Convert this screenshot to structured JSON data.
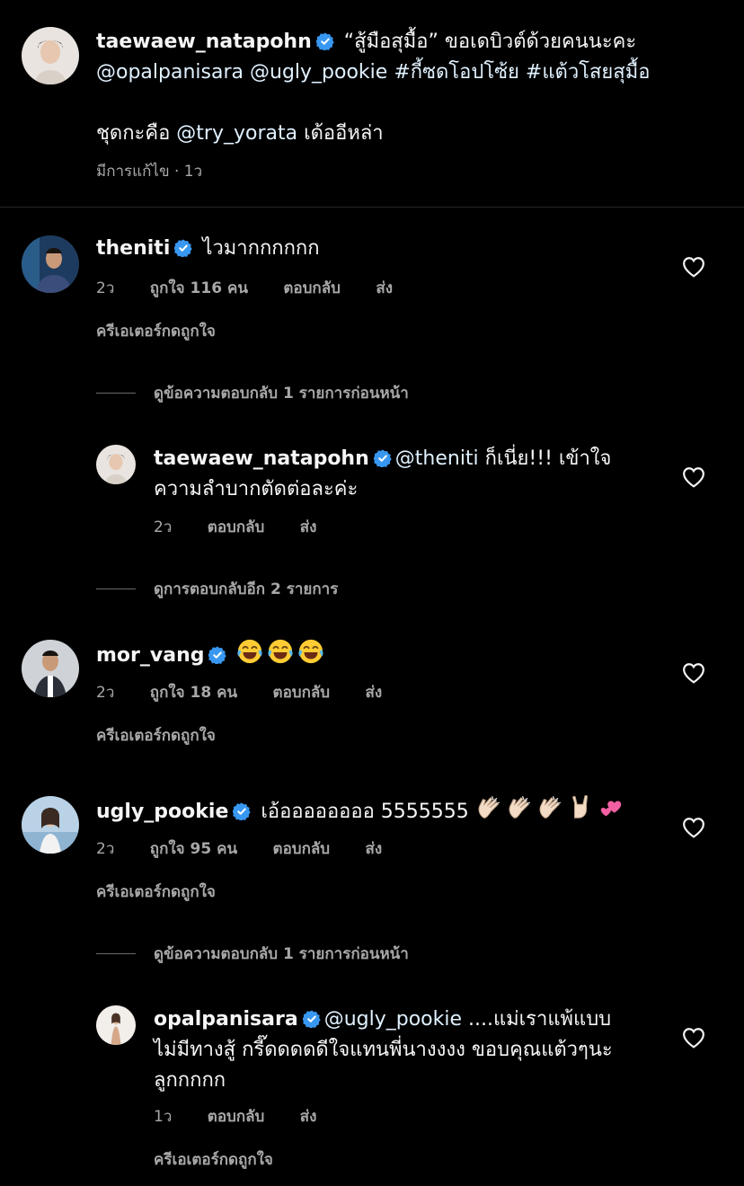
{
  "caption": {
    "username": "taewaew_natapohn",
    "line1": "“สู้มือสุมื้อ” ขอเดบิวต์ด้วยคนนะคะ",
    "line2_tags": [
      "@opalpanisara",
      "@ugly_pookie",
      "#กี้ซดโอปโซ้ย",
      "#แต้วโสยสุมื้อ"
    ],
    "line3_text": "ชุดกะคือ ",
    "line3_mention": "@try_yorata",
    "line3_after": " เด้ออีหล่า",
    "edited": "มีการแก้ไข · 1ว"
  },
  "comments": [
    {
      "username": "theniti",
      "text": "ไวมากกกกกก",
      "time": "2ว",
      "likes": "ถูกใจ 116 คน",
      "reply": "ตอบกลับ",
      "send": "ส่ง",
      "creator_liked": "ครีเอเตอร์กดถูกใจ",
      "view_replies": "ดูข้อความตอบกลับ 1 รายการก่อนหน้า"
    },
    {
      "username": "taewaew_natapohn",
      "mention": "@theniti",
      "text_line1": " ก็เนี่ย!!! เข้าใจ",
      "text_line2": "ความลำบากตัดต่อละค่ะ",
      "time": "2ว",
      "reply": "ตอบกลับ",
      "send": "ส่ง",
      "more_replies": "ดูการตอบกลับอีก 2 รายการ"
    },
    {
      "username": "mor_vang",
      "emojis": [
        "face-with-tears-of-joy",
        "face-with-tears-of-joy",
        "face-with-tears-of-joy"
      ],
      "time": "2ว",
      "likes": "ถูกใจ 18 คน",
      "reply": "ตอบกลับ",
      "send": "ส่ง",
      "creator_liked": "ครีเอเตอร์กดถูกใจ"
    },
    {
      "username": "ugly_pookie",
      "text": "เอ้ออออออออ 5555555",
      "emojis": [
        "clapping-hands",
        "clapping-hands",
        "clapping-hands",
        "sign-of-the-horns",
        "two-hearts"
      ],
      "time": "2ว",
      "likes": "ถูกใจ 95 คน",
      "reply": "ตอบกลับ",
      "send": "ส่ง",
      "creator_liked": "ครีเอเตอร์กดถูกใจ",
      "view_replies": "ดูข้อความตอบกลับ 1 รายการก่อนหน้า"
    },
    {
      "username": "opalpanisara",
      "mention": "@ugly_pookie",
      "text_line1": " ....แม่เราแพ้แบบ",
      "text_line2": "ไม่มีทางสู้ กรี๊ดดดดดีใจแทนพี่นางงงง ขอบคุณแต้วๆนะ",
      "text_line3": "ลูกกกกก",
      "time": "1ว",
      "reply": "ตอบกลับ",
      "send": "ส่ง",
      "creator_liked": "ครีเอเตอร์กดถูกใจ"
    }
  ],
  "colors": {
    "background": "#000000",
    "text": "#f5f5f5",
    "secondary": "#a8a8a8",
    "verified": "#3897f0",
    "mention": "#e0f1ff"
  }
}
